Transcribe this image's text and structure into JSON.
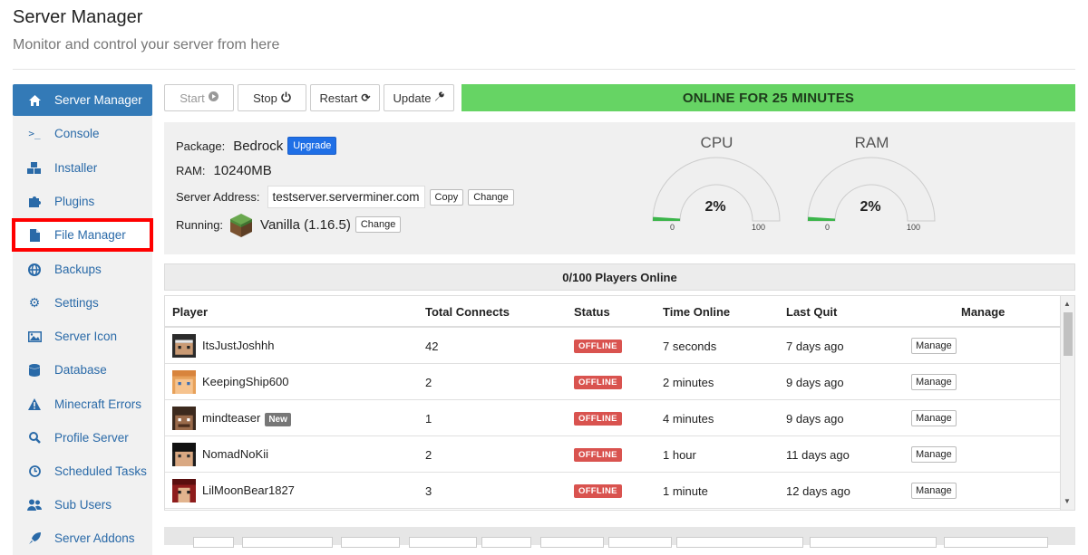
{
  "header": {
    "title": "Server Manager",
    "subtitle": "Monitor and control your server from here"
  },
  "sidebar": {
    "items": [
      {
        "label": "Server Manager",
        "icon": "home-icon",
        "active": true
      },
      {
        "label": "Console",
        "icon": "terminal-icon"
      },
      {
        "label": "Installer",
        "icon": "cubes-icon"
      },
      {
        "label": "Plugins",
        "icon": "puzzle-icon"
      },
      {
        "label": "File Manager",
        "icon": "file-icon",
        "highlighted": true
      },
      {
        "label": "Backups",
        "icon": "globe-icon"
      },
      {
        "label": "Settings",
        "icon": "gear-icon"
      },
      {
        "label": "Server Icon",
        "icon": "image-icon"
      },
      {
        "label": "Database",
        "icon": "database-icon"
      },
      {
        "label": "Minecraft Errors",
        "icon": "warning-icon"
      },
      {
        "label": "Profile Server",
        "icon": "search-icon"
      },
      {
        "label": "Scheduled Tasks",
        "icon": "clock-icon"
      },
      {
        "label": "Sub Users",
        "icon": "users-icon"
      },
      {
        "label": "Server Addons",
        "icon": "rocket-icon"
      }
    ]
  },
  "toolbar": {
    "start_label": "Start",
    "stop_label": "Stop",
    "restart_label": "Restart",
    "update_label": "Update",
    "status_text": "ONLINE FOR 25 MINUTES",
    "status_color": "#66d464"
  },
  "info": {
    "package_label": "Package:",
    "package_value": "Bedrock",
    "upgrade_label": "Upgrade",
    "ram_label": "RAM:",
    "ram_value": "10240MB",
    "address_label": "Server Address:",
    "address_value": "testserver.serverminer.com",
    "copy_label": "Copy",
    "change_label": "Change",
    "running_label": "Running:",
    "running_value": "Vanilla (1.16.5)",
    "running_change_label": "Change"
  },
  "gauges": {
    "cpu": {
      "label": "CPU",
      "value": "2%",
      "fraction": 0.02,
      "min": "0",
      "max": "100"
    },
    "ram": {
      "label": "RAM",
      "value": "2%",
      "fraction": 0.02,
      "min": "0",
      "max": "100"
    }
  },
  "players": {
    "summary": "0/100 Players Online",
    "columns": [
      "Player",
      "Total Connects",
      "Status",
      "Time Online",
      "Last Quit",
      "Manage"
    ],
    "rows": [
      {
        "name": "ItsJustJoshhh",
        "connects": "42",
        "status": "OFFLINE",
        "time_online": "7 seconds",
        "last_quit": "7 days ago",
        "manage": "Manage",
        "badge": ""
      },
      {
        "name": "KeepingShip600",
        "connects": "2",
        "status": "OFFLINE",
        "time_online": "2 minutes",
        "last_quit": "9 days ago",
        "manage": "Manage",
        "badge": ""
      },
      {
        "name": "mindteaser",
        "connects": "1",
        "status": "OFFLINE",
        "time_online": "4 minutes",
        "last_quit": "9 days ago",
        "manage": "Manage",
        "badge": "New"
      },
      {
        "name": "NomadNoKii",
        "connects": "2",
        "status": "OFFLINE",
        "time_online": "1 hour",
        "last_quit": "11 days ago",
        "manage": "Manage",
        "badge": ""
      },
      {
        "name": "LilMoonBear1827",
        "connects": "3",
        "status": "OFFLINE",
        "time_online": "1 minute",
        "last_quit": "12 days ago",
        "manage": "Manage",
        "badge": ""
      }
    ]
  }
}
